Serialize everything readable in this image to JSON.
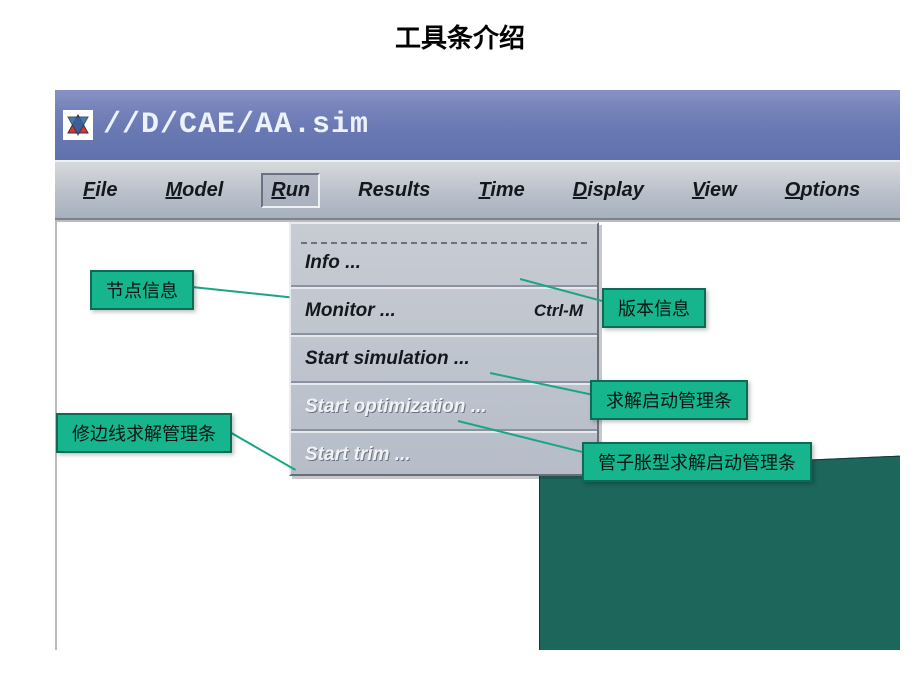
{
  "page_title": "工具条介绍",
  "titlebar": {
    "path": "//D/CAE/AA.sim"
  },
  "menubar": {
    "items": [
      "File",
      "Model",
      "Run",
      "Results",
      "Time",
      "Display",
      "View",
      "Options"
    ],
    "active_index": 2
  },
  "dropdown": {
    "items": [
      {
        "label": "Info ...",
        "shortcut": "",
        "disabled": false
      },
      {
        "label": "Monitor ...",
        "shortcut": "Ctrl-M",
        "disabled": false
      },
      {
        "label": "Start simulation ...",
        "shortcut": "",
        "disabled": false
      },
      {
        "label": "Start optimization ...",
        "shortcut": "",
        "disabled": true
      },
      {
        "label": "Start trim ...",
        "shortcut": "",
        "disabled": true
      }
    ]
  },
  "callouts": {
    "node_info": {
      "label": "节点信息"
    },
    "version_info": {
      "label": "版本信息"
    },
    "solver_start": {
      "label": "求解启动管理条"
    },
    "tube_solver": {
      "label": "管子胀型求解启动管理条"
    },
    "trim_solver": {
      "label": "修边线求解管理条"
    }
  }
}
